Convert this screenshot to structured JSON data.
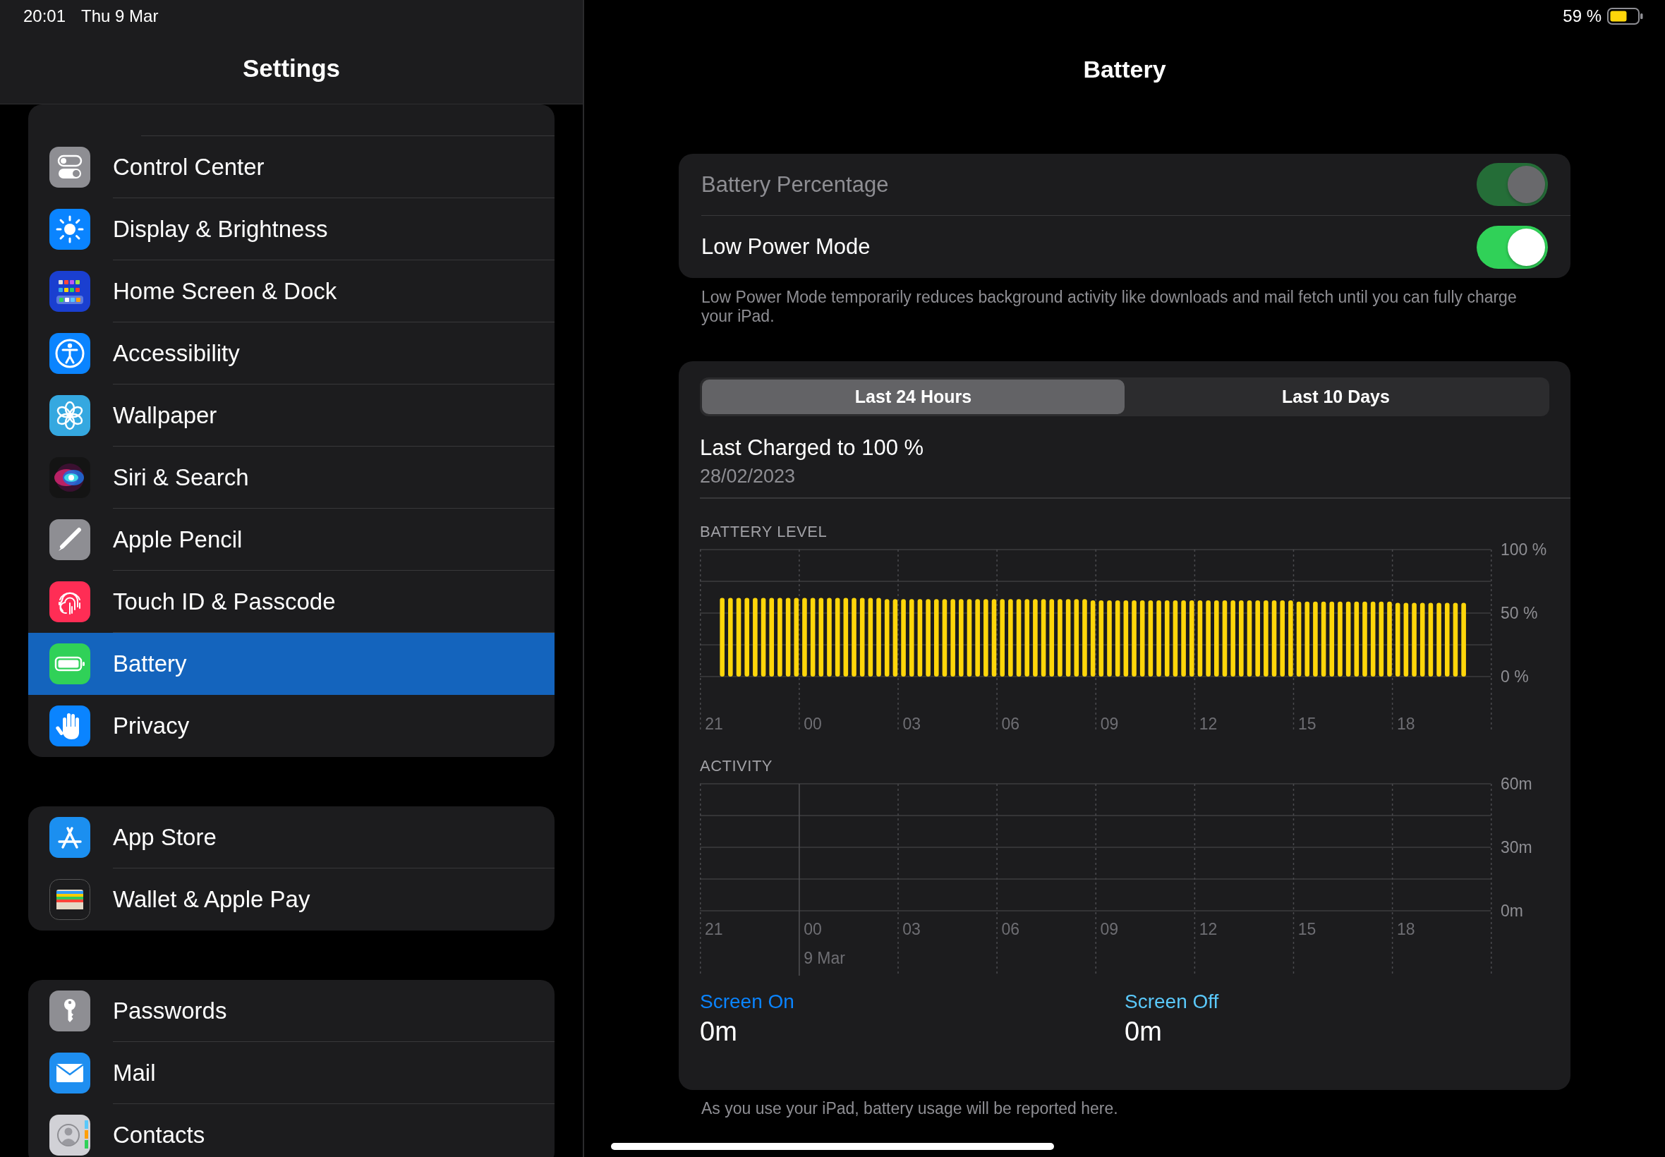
{
  "status_bar": {
    "time": "20:01",
    "date": "Thu 9 Mar",
    "battery": "59 %"
  },
  "sidebar": {
    "title": "Settings",
    "groups": [
      {
        "items": [
          {
            "label": "Control Center",
            "selected": false
          },
          {
            "label": "Display & Brightness",
            "selected": false
          },
          {
            "label": "Home Screen & Dock",
            "selected": false
          },
          {
            "label": "Accessibility",
            "selected": false
          },
          {
            "label": "Wallpaper",
            "selected": false
          },
          {
            "label": "Siri & Search",
            "selected": false
          },
          {
            "label": "Apple Pencil",
            "selected": false
          },
          {
            "label": "Touch ID & Passcode",
            "selected": false
          },
          {
            "label": "Battery",
            "selected": true
          },
          {
            "label": "Privacy",
            "selected": false
          }
        ]
      },
      {
        "items": [
          {
            "label": "App Store",
            "selected": false
          },
          {
            "label": "Wallet & Apple Pay",
            "selected": false
          }
        ]
      },
      {
        "items": [
          {
            "label": "Passwords",
            "selected": false
          },
          {
            "label": "Mail",
            "selected": false
          },
          {
            "label": "Contacts",
            "selected": false
          }
        ]
      }
    ]
  },
  "detail": {
    "title": "Battery",
    "toggles": [
      {
        "label": "Battery Percentage",
        "on": true,
        "disabled": true
      },
      {
        "label": "Low Power Mode",
        "on": true,
        "disabled": false
      }
    ],
    "toggles_footer": "Low Power Mode temporarily reduces background activity like downloads and mail fetch until you can fully charge your iPad.",
    "segments": [
      {
        "label": "Last 24 Hours",
        "selected": true
      },
      {
        "label": "Last 10 Days",
        "selected": false
      }
    ],
    "last_charged": {
      "title": "Last Charged to 100 %",
      "date": "28/02/2023"
    },
    "battery_level": {
      "heading": "BATTERY LEVEL",
      "chart_data": {
        "type": "bar",
        "categories": [
          "21",
          null,
          null,
          null,
          null,
          null,
          null,
          null,
          null,
          null,
          null,
          null,
          "00",
          null,
          null,
          null,
          null,
          null,
          null,
          null,
          null,
          null,
          null,
          null,
          "03",
          null,
          null,
          null,
          null,
          null,
          null,
          null,
          null,
          null,
          null,
          null,
          "06",
          null,
          null,
          null,
          null,
          null,
          null,
          null,
          null,
          null,
          null,
          null,
          "09",
          null,
          null,
          null,
          null,
          null,
          null,
          null,
          null,
          null,
          null,
          null,
          "12",
          null,
          null,
          null,
          null,
          null,
          null,
          null,
          null,
          null,
          null,
          null,
          "15",
          null,
          null,
          null,
          null,
          null,
          null,
          null,
          null,
          null,
          null,
          null,
          "18",
          null,
          null,
          null,
          null,
          null,
          null,
          null,
          null,
          null,
          null,
          null
        ],
        "series": [
          {
            "color": "#ffd60a",
            "values": [
              null,
              62,
              62,
              62,
              62,
              62,
              62,
              62,
              62,
              62,
              62,
              62,
              62,
              62,
              62,
              62,
              62,
              62,
              62,
              62,
              62,
              61,
              61,
              61,
              61,
              61,
              61,
              61,
              61,
              61,
              61,
              61,
              61,
              61,
              61,
              61,
              61,
              61,
              61,
              61,
              61,
              61,
              61,
              61,
              61,
              61,
              60,
              60,
              60,
              60,
              60,
              60,
              60,
              60,
              60,
              60,
              60,
              60,
              60,
              60,
              60,
              60,
              60,
              60,
              60,
              60,
              60,
              60,
              60,
              60,
              60,
              59,
              59,
              59,
              59,
              59,
              59,
              59,
              59,
              59,
              59,
              59,
              59,
              58,
              58,
              58,
              58,
              58,
              58,
              58,
              58,
              58,
              null,
              null,
              null,
              null
            ]
          }
        ],
        "ylim": [
          0,
          100
        ],
        "yticks": [
          {
            "value": 0,
            "label": "0 %"
          },
          {
            "value": 50,
            "label": "50 %"
          },
          {
            "value": 100,
            "label": "100 %"
          }
        ]
      }
    },
    "activity": {
      "heading": "ACTIVITY",
      "y_labels": [
        "60m",
        "30m",
        "0m"
      ],
      "x_labels": [
        {
          "text": "21"
        },
        {
          "text": "00",
          "date": "9 Mar"
        },
        {
          "text": "03"
        },
        {
          "text": "06"
        },
        {
          "text": "09"
        },
        {
          "text": "12"
        },
        {
          "text": "15"
        },
        {
          "text": "18"
        }
      ]
    },
    "screen_time": [
      {
        "label": "Screen On",
        "value": "0m",
        "color": "#0a84ff"
      },
      {
        "label": "Screen Off",
        "value": "0m",
        "color": "#5ac8fa"
      }
    ],
    "footer": "As you use your iPad, battery usage will be reported here."
  }
}
